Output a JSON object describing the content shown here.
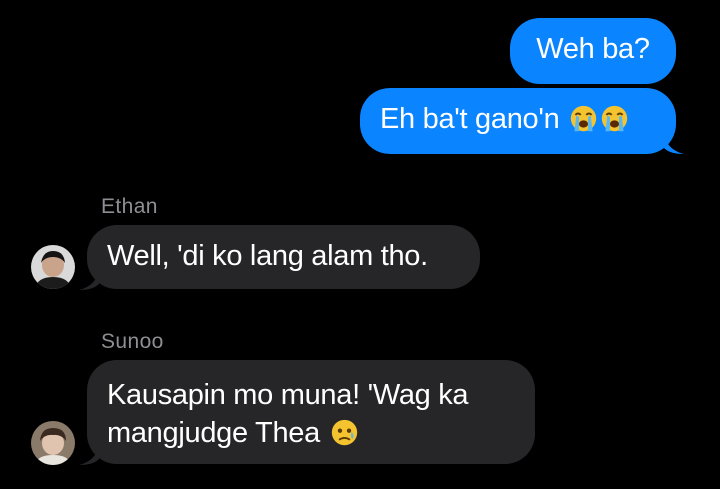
{
  "conversation": {
    "outgoing": [
      {
        "text": "Weh ba?"
      },
      {
        "text": "Eh ba't gano'n",
        "emoji": [
          "loudly-crying-face",
          "loudly-crying-face"
        ]
      }
    ],
    "incoming": [
      {
        "sender": "Ethan",
        "text": "Well, 'di ko lang alam tho."
      },
      {
        "sender": "Sunoo",
        "lines": [
          "Kausapin mo muna! 'Wag ka",
          "mangjudge Thea"
        ],
        "emoji": [
          "face-holding-back-tears"
        ]
      }
    ]
  },
  "colors": {
    "background": "#000000",
    "outgoing_bubble": "#0a84ff",
    "incoming_bubble": "#262629",
    "sender_name": "#8e8e93",
    "text": "#ffffff"
  }
}
